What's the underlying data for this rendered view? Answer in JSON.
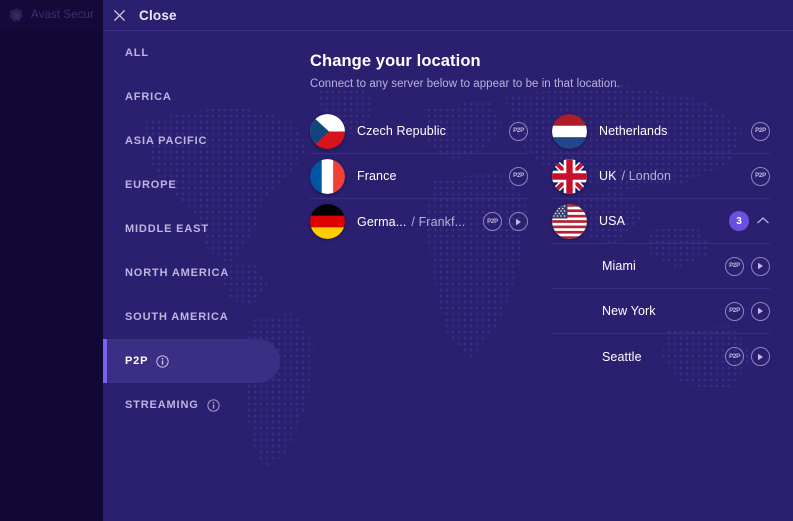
{
  "background_window": {
    "title": "Avast Secur",
    "logo_icon": "avast-logo-icon"
  },
  "modal": {
    "header": {
      "close_label": "Close",
      "close_icon": "close-x-icon"
    },
    "title": "Change your location",
    "subtitle": "Connect to any server below to appear to be in that location.",
    "colors": {
      "modal_background": "#2b2070",
      "app_background": "#150a42",
      "accent": "#7a62f0",
      "badge_purple": "#6a4fe0",
      "active_pill": "#3b2f85",
      "divider": "#3a2e82"
    }
  },
  "sidebar": {
    "items": [
      {
        "label": "ALL",
        "active": false,
        "info_icon": null
      },
      {
        "label": "AFRICA",
        "active": false,
        "info_icon": null
      },
      {
        "label": "ASIA PACIFIC",
        "active": false,
        "info_icon": null
      },
      {
        "label": "EUROPE",
        "active": false,
        "info_icon": null
      },
      {
        "label": "MIDDLE EAST",
        "active": false,
        "info_icon": null
      },
      {
        "label": "NORTH AMERICA",
        "active": false,
        "info_icon": null
      },
      {
        "label": "SOUTH AMERICA",
        "active": false,
        "info_icon": null
      },
      {
        "label": "P2P",
        "active": true,
        "info_icon": "info-circle-icon"
      },
      {
        "label": "STREAMING",
        "active": false,
        "info_icon": "info-circle-icon"
      }
    ]
  },
  "servers": {
    "left_column": [
      {
        "country": "Czech Republic",
        "city": "",
        "flag": "czech-republic-flag",
        "p2p": "P2P",
        "streaming": false,
        "count": null,
        "expanded": null
      },
      {
        "country": "France",
        "city": "",
        "flag": "france-flag",
        "p2p": "P2P",
        "streaming": false,
        "count": null,
        "expanded": null
      },
      {
        "country": "Germa...",
        "city": "/ Frankf...",
        "flag": "germany-flag",
        "p2p": "P2P",
        "streaming": true,
        "count": null,
        "expanded": null
      }
    ],
    "right_column": [
      {
        "country": "Netherlands",
        "city": "",
        "flag": "netherlands-flag",
        "p2p": "P2P",
        "streaming": false,
        "count": null,
        "expanded": null
      },
      {
        "country": "UK",
        "city": "/ London",
        "flag": "uk-flag",
        "p2p": "P2P",
        "streaming": false,
        "count": null,
        "expanded": null
      },
      {
        "country": "USA",
        "city": "",
        "flag": "usa-flag",
        "p2p": null,
        "streaming": false,
        "count": "3",
        "expanded": true
      }
    ],
    "usa_cities": [
      {
        "name": "Miami",
        "p2p": "P2P",
        "streaming": true
      },
      {
        "name": "New York",
        "p2p": "P2P",
        "streaming": true
      },
      {
        "name": "Seattle",
        "p2p": "P2P",
        "streaming": true
      }
    ]
  }
}
